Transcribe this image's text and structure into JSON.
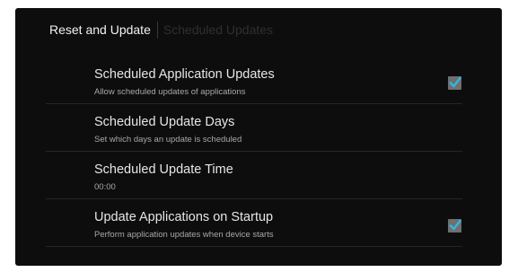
{
  "header": {
    "current_section": "Reset and Update",
    "next_section": "Scheduled Updates"
  },
  "settings": [
    {
      "title": "Scheduled Application Updates",
      "subtitle": "Allow scheduled updates of applications",
      "has_checkbox": true,
      "checked": true
    },
    {
      "title": "Scheduled Update Days",
      "subtitle": "Set which days an update is scheduled",
      "has_checkbox": false
    },
    {
      "title": "Scheduled Update Time",
      "subtitle": "00:00",
      "has_checkbox": false
    },
    {
      "title": "Update Applications on Startup",
      "subtitle": "Perform application updates when device starts",
      "has_checkbox": true,
      "checked": true
    }
  ],
  "colors": {
    "background": "#0d0d0d",
    "checkmark": "#33b5e5",
    "checkbox_fill": "#6f6f6f"
  }
}
